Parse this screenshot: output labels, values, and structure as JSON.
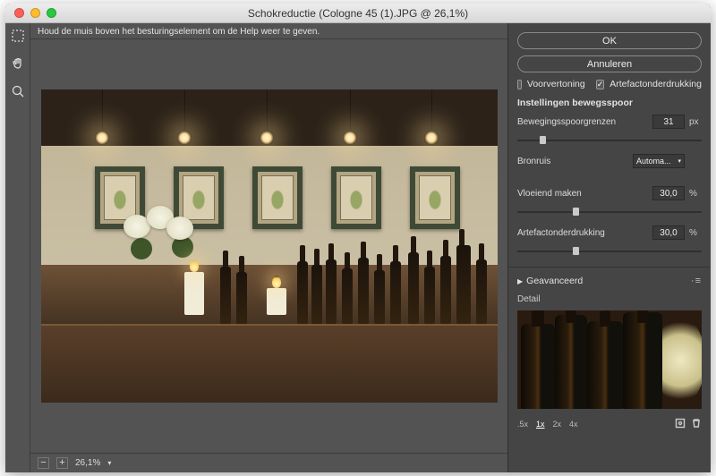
{
  "window": {
    "title": "Schokreductie (Cologne 45 (1).JPG @ 26,1%)"
  },
  "hint_text": "Houd de muis boven het besturingselement om de Help weer te geven.",
  "status": {
    "zoom": "26,1%"
  },
  "panel": {
    "ok": "OK",
    "cancel": "Annuleren",
    "checkbox_preview": "Voorvertoning",
    "checkbox_artifact": "Artefactonderdrukking",
    "section_motion": "Instellingen bewegsspoor",
    "controls": {
      "blur_bounds": {
        "label": "Bewegingsspoorgrenzen",
        "value": "31",
        "unit": "px",
        "pos": 12
      },
      "source_noise": {
        "label": "Bronruis",
        "value": "Automa..."
      },
      "smoothing": {
        "label": "Vloeiend maken",
        "value": "30,0",
        "unit": "%",
        "pos": 30
      },
      "artifact_supp": {
        "label": "Artefactonderdrukking",
        "value": "30,0",
        "unit": "%",
        "pos": 30
      }
    },
    "advanced": "Geavanceerd",
    "detail_label": "Detail",
    "zoom_levels": {
      "a": ".5x",
      "b": "1x",
      "c": "2x",
      "d": "4x"
    }
  }
}
